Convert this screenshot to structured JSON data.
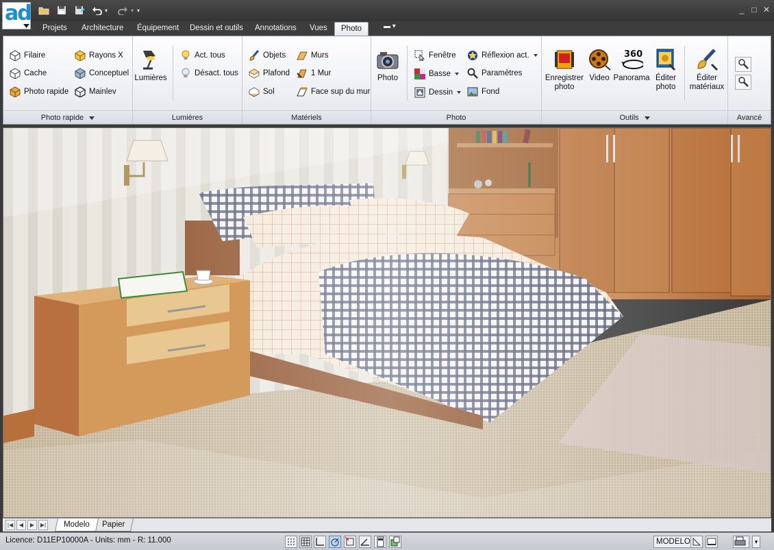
{
  "app": {
    "logo": "ad"
  },
  "tabs": [
    "Projets",
    "Architecture",
    "Équipement",
    "Dessin et outils",
    "Annotations",
    "Vues",
    "Photo"
  ],
  "active_tab": "Photo",
  "ribbon": {
    "photo_rapide": {
      "title": "Photo rapide",
      "items": [
        "Filaire",
        "Rayons X",
        "Cache",
        "Conceptuel",
        "Photo rapide",
        "Mainlev"
      ]
    },
    "lumieres": {
      "title": "Lumières",
      "large": "Lumières",
      "items": [
        "Act. tous",
        "Désact. tous"
      ]
    },
    "materiels": {
      "title": "Matériels",
      "items": [
        "Objets",
        "Murs",
        "Plafond",
        "1 Mur",
        "Sol",
        "Face sup du mur"
      ]
    },
    "photo": {
      "title": "Photo",
      "large": "Photo",
      "items": [
        "Fenêtre",
        "Réflexion act.",
        "Basse",
        "Paramètres",
        "Dessin",
        "Fond"
      ]
    },
    "outils": {
      "title": "Outils",
      "enregistrer_1": "Enregistrer",
      "enregistrer_2": "photo",
      "video": "Video",
      "panorama": "Panorama",
      "panorama_badge": "360°",
      "editer_photo_1": "Éditer",
      "editer_photo_2": "photo",
      "editer_mat_1": "Éditer",
      "editer_mat_2": "matériaux"
    },
    "avance": {
      "title": "Avancé"
    }
  },
  "sheets": [
    "Modelo",
    "Papier"
  ],
  "status": {
    "license": "Licence: D11EP10000A - Units: mm - R: 11.000",
    "mode": "MODELO"
  },
  "colors": {
    "accent": "#1a8fd0",
    "ribbon_bg": "#eceef2",
    "dark_frame": "#3a3a3a"
  }
}
